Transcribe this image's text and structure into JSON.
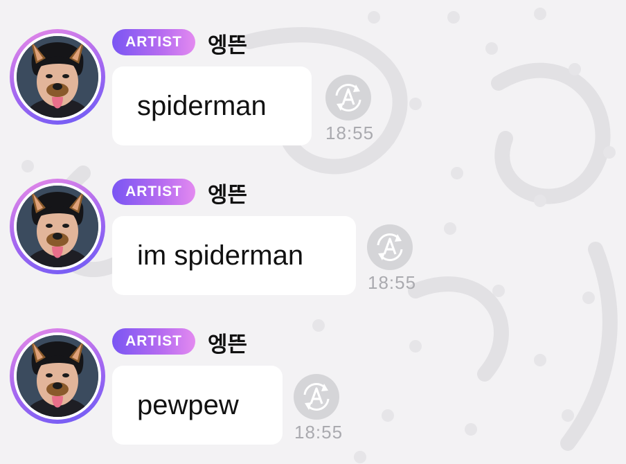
{
  "messages": [
    {
      "badge": "ARTIST",
      "sender": "엥뜬",
      "text": "spiderman",
      "time": "18:55",
      "translate_icon": "translate-icon"
    },
    {
      "badge": "ARTIST",
      "sender": "엥뜬",
      "text": "im spiderman",
      "time": "18:55",
      "translate_icon": "translate-icon"
    },
    {
      "badge": "ARTIST",
      "sender": "엥뜬",
      "text": "pewpew",
      "time": "18:55",
      "translate_icon": "translate-icon"
    }
  ],
  "colors": {
    "badge_start": "#7a56f3",
    "badge_end": "#e38af0",
    "bubble": "#ffffff",
    "background": "#f3f2f4",
    "timestamp": "#aaaaaf",
    "translate_button": "#d5d5d8"
  }
}
